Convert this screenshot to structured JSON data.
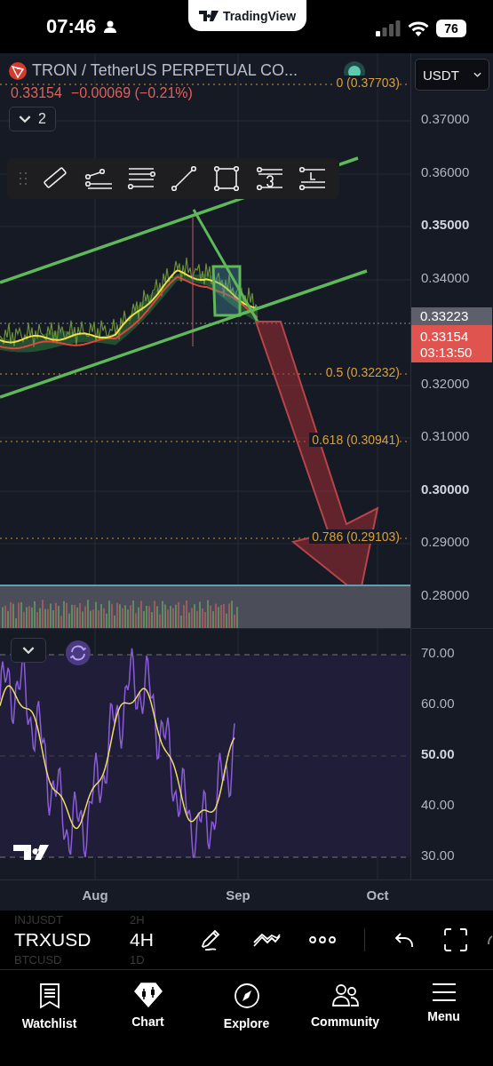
{
  "status_bar": {
    "time": "07:46",
    "battery": "76"
  },
  "banner": {
    "title": "TradingView"
  },
  "symbol": {
    "title": "TRON / TetherUS PERPETUAL CO...",
    "last": "0.33154",
    "change": "−0.00069 (−0.21%)",
    "indicator_count": "2",
    "live": true
  },
  "currency": "USDT",
  "fib_levels": [
    {
      "label": "0 (0.37703)"
    },
    {
      "label": "0.5 (0.32232)"
    },
    {
      "label": "0.618 (0.30941)"
    },
    {
      "label": "0.786 (0.29103)"
    }
  ],
  "price_axis": {
    "ticks": [
      {
        "label": "0.37000",
        "major": false
      },
      {
        "label": "0.36000",
        "major": false
      },
      {
        "label": "0.35000",
        "major": true
      },
      {
        "label": "0.34000",
        "major": false
      },
      {
        "label": "0.32000",
        "major": false
      },
      {
        "label": "0.31000",
        "major": false
      },
      {
        "label": "0.30000",
        "major": true
      },
      {
        "label": "0.29000",
        "major": false
      },
      {
        "label": "0.28000",
        "major": false
      }
    ]
  },
  "price_labels": [
    {
      "kind": "crosshair",
      "value": "0.33223"
    },
    {
      "kind": "last",
      "value": "0.33154",
      "countdown": "03:13:50"
    }
  ],
  "rsi_axis": {
    "ticks": [
      {
        "label": "70.00",
        "major": false
      },
      {
        "label": "60.00",
        "major": false
      },
      {
        "label": "50.00",
        "major": true
      },
      {
        "label": "40.00",
        "major": false
      },
      {
        "label": "30.00",
        "major": false
      }
    ]
  },
  "time_axis": [
    "Aug",
    "Sep",
    "Oct"
  ],
  "symbol_switcher": [
    {
      "symbol": "INJUSDT",
      "interval": "2H",
      "selected": false
    },
    {
      "symbol": "TRXUSD",
      "interval": "4H",
      "selected": true
    },
    {
      "symbol": "BTCUSD",
      "interval": "1D",
      "selected": false
    }
  ],
  "tabs": [
    {
      "label": "Watchlist",
      "selected": false
    },
    {
      "label": "Chart",
      "selected": true
    },
    {
      "label": "Explore",
      "selected": false
    },
    {
      "label": "Community",
      "selected": false
    },
    {
      "label": "Menu",
      "selected": false
    }
  ]
}
